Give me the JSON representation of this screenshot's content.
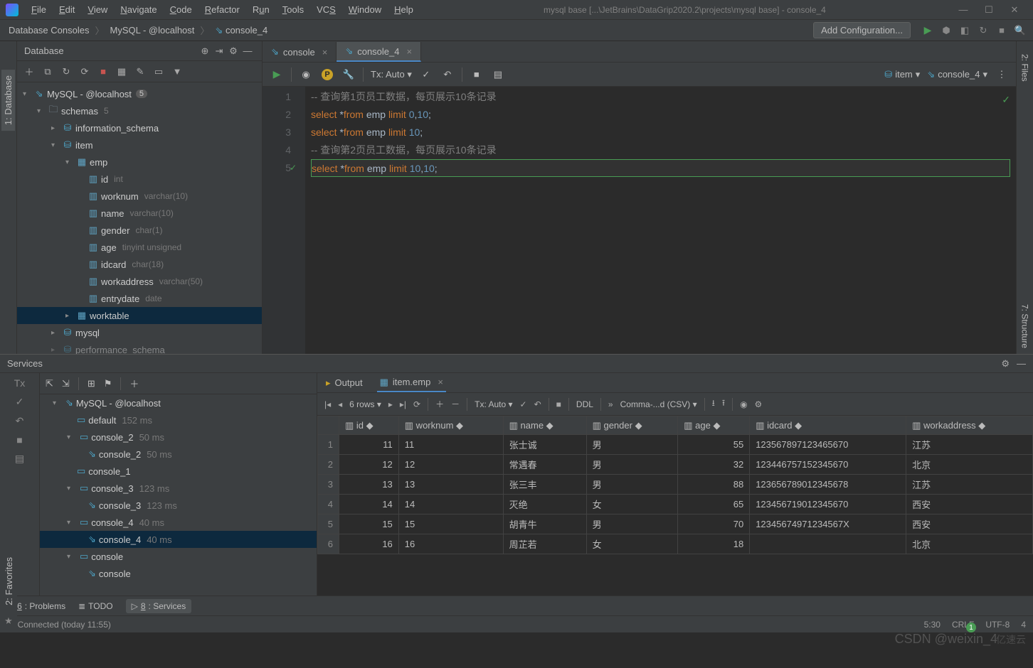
{
  "window": {
    "title": "mysql base [...\\JetBrains\\DataGrip2020.2\\projects\\mysql base] - console_4"
  },
  "menu": [
    "File",
    "Edit",
    "View",
    "Navigate",
    "Code",
    "Refactor",
    "Run",
    "Tools",
    "VCS",
    "Window",
    "Help"
  ],
  "breadcrumbs": [
    "Database Consoles",
    "MySQL - @localhost",
    "console_4"
  ],
  "nav": {
    "addconf": "Add Configuration..."
  },
  "sidebar": {
    "title": "Database",
    "root": {
      "label": "MySQL - @localhost",
      "badge": "5"
    },
    "schemas": {
      "label": "schemas",
      "badge": "5"
    },
    "info_schema": "information_schema",
    "item": "item",
    "emp": "emp",
    "columns": [
      {
        "name": "id",
        "type": "int"
      },
      {
        "name": "worknum",
        "type": "varchar(10)"
      },
      {
        "name": "name",
        "type": "varchar(10)"
      },
      {
        "name": "gender",
        "type": "char(1)"
      },
      {
        "name": "age",
        "type": "tinyint unsigned"
      },
      {
        "name": "idcard",
        "type": "char(18)"
      },
      {
        "name": "workaddress",
        "type": "varchar(50)"
      },
      {
        "name": "entrydate",
        "type": "date"
      }
    ],
    "worktable": "worktable",
    "mysql": "mysql",
    "perf": "performance_schema"
  },
  "tabs": {
    "t1": "console",
    "t2": "console_4"
  },
  "edtb": {
    "tx": "Tx: Auto",
    "sel_item": "item",
    "sel_console": "console_4"
  },
  "code": {
    "l1": "-- 查询第1页员工数据，每页展示10条记录",
    "l4": "-- 查询第2页员工数据，每页展示10条记录",
    "kw_select": "select",
    "kw_from": "from",
    "kw_limit": "limit",
    "tbl": "emp",
    "star": "*",
    "n0": "0",
    "n10": "10",
    "semi": ";",
    "comma": ","
  },
  "services": {
    "title": "Services",
    "conn": "MySQL - @localhost",
    "default": {
      "label": "default",
      "ms": "152 ms"
    },
    "c2": {
      "label": "console_2",
      "ms": "50 ms"
    },
    "c1": {
      "label": "console_1"
    },
    "c3": {
      "label": "console_3",
      "ms": "123 ms"
    },
    "c4": {
      "label": "console_4",
      "ms": "40 ms"
    },
    "cc": {
      "label": "console"
    }
  },
  "results": {
    "out_tab": "Output",
    "data_tab": "item.emp",
    "rows_label": "6 rows",
    "tx": "Tx: Auto",
    "ddl": "DDL",
    "csv": "Comma-...d (CSV)",
    "headers": [
      "id",
      "worknum",
      "name",
      "gender",
      "age",
      "idcard",
      "workaddress"
    ],
    "rows": [
      {
        "id": "11",
        "worknum": "11",
        "name": "张士诚",
        "gender": "男",
        "age": "55",
        "idcard": "123567897123465670",
        "workaddress": "江苏"
      },
      {
        "id": "12",
        "worknum": "12",
        "name": "常遇春",
        "gender": "男",
        "age": "32",
        "idcard": "123446757152345670",
        "workaddress": "北京"
      },
      {
        "id": "13",
        "worknum": "13",
        "name": "张三丰",
        "gender": "男",
        "age": "88",
        "idcard": "123656789012345678",
        "workaddress": "江苏"
      },
      {
        "id": "14",
        "worknum": "14",
        "name": "灭绝",
        "gender": "女",
        "age": "65",
        "idcard": "123456719012345670",
        "workaddress": "西安"
      },
      {
        "id": "15",
        "worknum": "15",
        "name": "胡青牛",
        "gender": "男",
        "age": "70",
        "idcard": "12345674971234567X",
        "workaddress": "西安"
      },
      {
        "id": "16",
        "worknum": "16",
        "name": "周芷若",
        "gender": "女",
        "age": "18",
        "idcard": "<null>",
        "workaddress": "北京"
      }
    ]
  },
  "bottom": {
    "problems": "6: Problems",
    "todo": "TODO",
    "services": "8: Services"
  },
  "status": {
    "conn": "Connected (today 11:55)",
    "pos": "5:30",
    "crlf": "CRLF",
    "enc": "UTF-8",
    "tab": "4"
  },
  "watermark": "CSDN @weixin_4",
  "watermark2": "亿速云",
  "right_tabs": {
    "files": "2: Files",
    "structure": "7: Structure"
  },
  "left_tabs": {
    "database": "1: Database",
    "fav": "2: Favorites"
  }
}
